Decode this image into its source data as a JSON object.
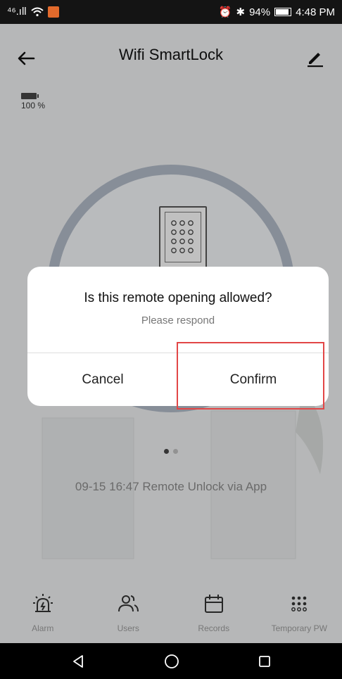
{
  "statusbar": {
    "left_signal": "⁴⁶.ıll",
    "battery_pct": "94%",
    "time": "4:48 PM"
  },
  "header": {
    "title": "Wifi SmartLock",
    "back_icon": "arrow-left-icon",
    "edit_icon": "pencil-icon"
  },
  "battery": {
    "text": "100 %"
  },
  "lock": {
    "pager_active_index": 0,
    "pages": 2
  },
  "log": {
    "text": "09-15 16:47  Remote Unlock via App"
  },
  "bottom_nav": {
    "items": [
      {
        "label": "Alarm",
        "icon": "alarm-icon"
      },
      {
        "label": "Users",
        "icon": "users-icon"
      },
      {
        "label": "Records",
        "icon": "calendar-icon"
      },
      {
        "label": "Temporary PW",
        "icon": "keypad-icon"
      }
    ]
  },
  "dialog": {
    "title": "Is this remote opening allowed?",
    "subtitle": "Please respond",
    "cancel_label": "Cancel",
    "confirm_label": "Confirm"
  },
  "colors": {
    "highlight": "#e24646",
    "ring": "#aeb6c3"
  }
}
